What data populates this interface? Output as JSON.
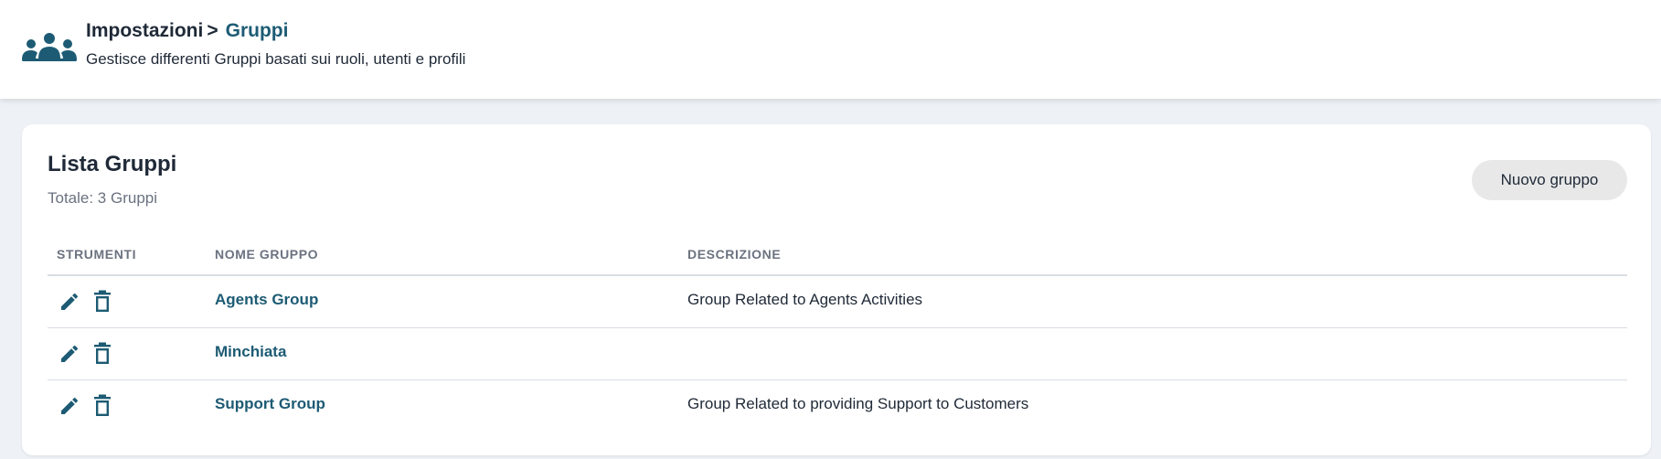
{
  "header": {
    "icon": "groups-icon",
    "breadcrumb_root": "Impostazioni",
    "breadcrumb_separator": ">",
    "breadcrumb_current": "Gruppi",
    "subtitle": "Gestisce differenti Gruppi basati sui ruoli, utenti e profili"
  },
  "card": {
    "title": "Lista Gruppi",
    "total": "Totale: 3 Gruppi",
    "new_button": "Nuovo gruppo"
  },
  "table": {
    "columns": {
      "tools": "STRUMENTI",
      "name": "NOME GRUPPO",
      "description": "DESCRIZIONE"
    },
    "row_icons": [
      "edit-icon",
      "trash-icon"
    ],
    "rows": [
      {
        "name": "Agents Group",
        "description": "Group Related to Agents Activities"
      },
      {
        "name": "Minchiata",
        "description": ""
      },
      {
        "name": "Support Group",
        "description": "Group Related to providing Support to Customers"
      }
    ]
  },
  "colors": {
    "accent": "#1d5b74",
    "text": "#1f2937",
    "muted": "#6b7280",
    "background": "#eef2f6",
    "button_bg": "#e8e8e8"
  }
}
